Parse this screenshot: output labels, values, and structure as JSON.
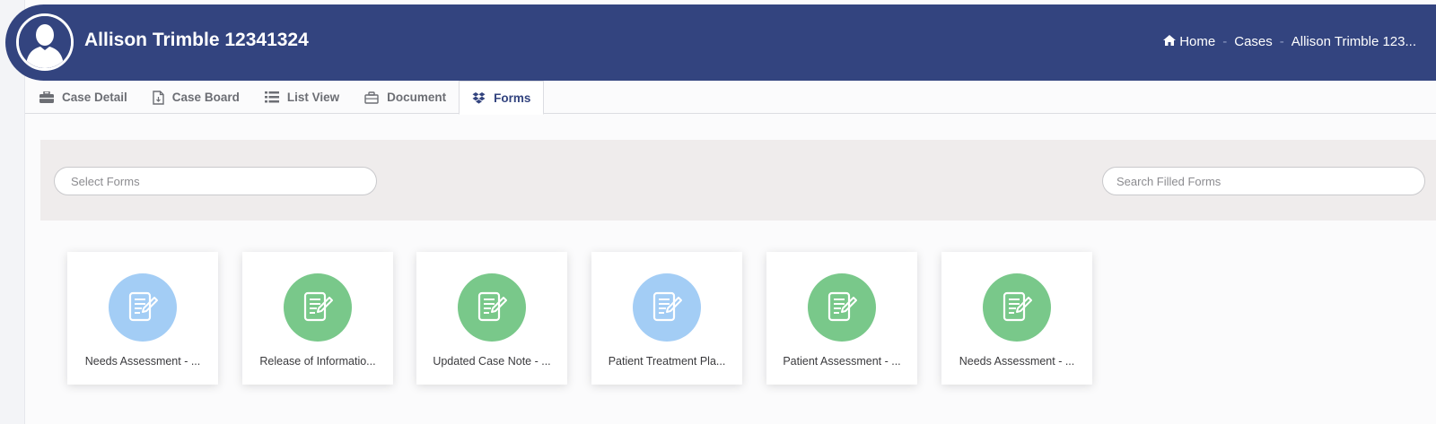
{
  "header": {
    "title": "Allison Trimble 12341324",
    "bg_color": "#33447f",
    "avatar_icon": "user-silhouette-icon"
  },
  "breadcrumb": {
    "home_icon": "home-icon",
    "items": [
      "Home",
      "Cases",
      "Allison Trimble 123..."
    ]
  },
  "tabs": [
    {
      "label": "Case Detail",
      "icon": "briefcase-icon",
      "active": false
    },
    {
      "label": "Case Board",
      "icon": "file-document-icon",
      "active": false
    },
    {
      "label": "List View",
      "icon": "list-icon",
      "active": false
    },
    {
      "label": "Document",
      "icon": "folder-icon",
      "active": false
    },
    {
      "label": "Forms",
      "icon": "dropbox-icon",
      "active": true
    }
  ],
  "filters": {
    "select_forms_placeholder": "Select Forms",
    "search_filled_placeholder": "Search Filled Forms"
  },
  "cards": [
    {
      "label": "Needs Assessment - ...",
      "color": "#a3cdf5",
      "icon": "form-edit-icon"
    },
    {
      "label": "Release of Informatio...",
      "color": "#79c88a",
      "icon": "form-edit-icon"
    },
    {
      "label": "Updated Case Note - ...",
      "color": "#79c88a",
      "icon": "form-edit-icon"
    },
    {
      "label": "Patient Treatment Pla...",
      "color": "#a3cdf5",
      "icon": "form-edit-icon"
    },
    {
      "label": "Patient Assessment - ...",
      "color": "#79c88a",
      "icon": "form-edit-icon"
    },
    {
      "label": "Needs Assessment - ...",
      "color": "#79c88a",
      "icon": "form-edit-icon"
    }
  ]
}
